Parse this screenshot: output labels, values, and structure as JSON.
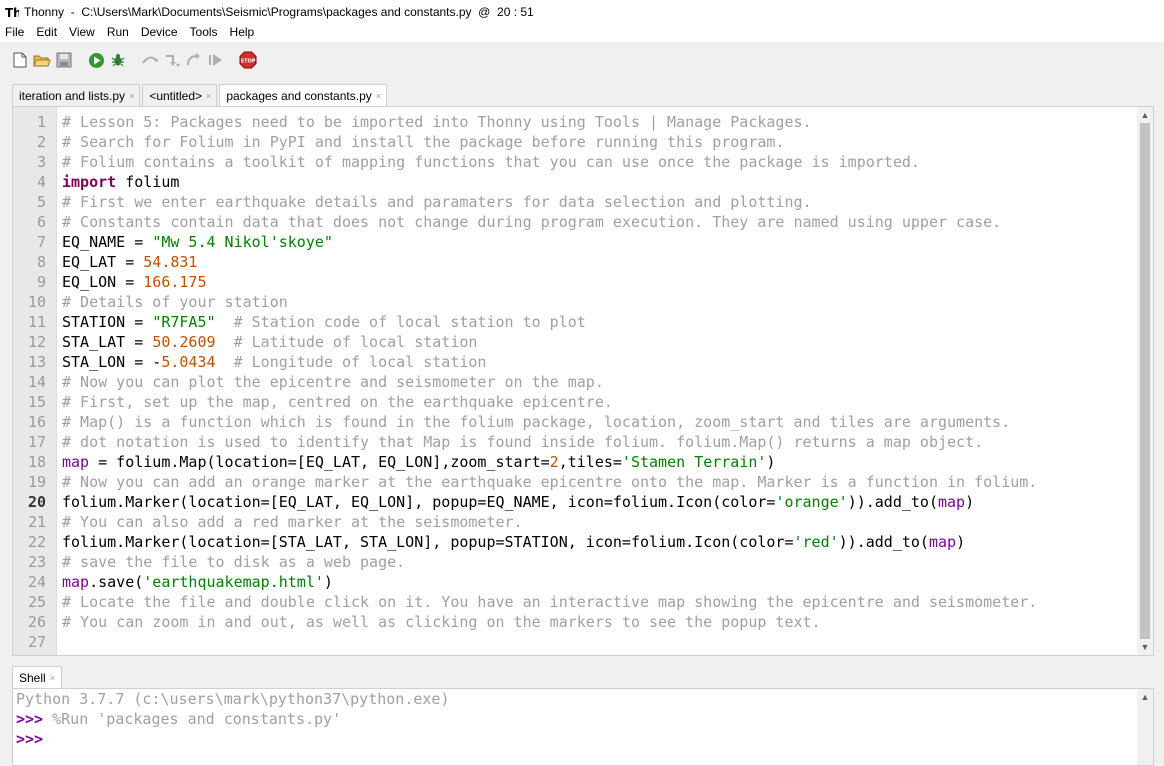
{
  "window": {
    "title": "Thonny  -  C:\\Users\\Mark\\Documents\\Seismic\\Programs\\packages and constants.py  @  20 : 51"
  },
  "menu": [
    "File",
    "Edit",
    "View",
    "Run",
    "Device",
    "Tools",
    "Help"
  ],
  "toolbar": {
    "buttons": [
      "new-file-icon",
      "open-file-icon",
      "save-icon",
      "run-icon",
      "debug-icon",
      "step-over-icon",
      "step-into-icon",
      "step-out-icon",
      "resume-icon",
      "stop-icon"
    ],
    "stop_label": "STOP"
  },
  "tabs": [
    {
      "label": "iteration and lists.py",
      "close": "×"
    },
    {
      "label": "<untitled>",
      "close": "×"
    },
    {
      "label": "packages and constants.py",
      "close": "×"
    }
  ],
  "editor": {
    "current_line": 20,
    "line_numbers": [
      "1",
      "2",
      "3",
      "4",
      "5",
      "6",
      "7",
      "8",
      "9",
      "10",
      "11",
      "12",
      "13",
      "14",
      "15",
      "16",
      "17",
      "18",
      "19",
      "20",
      "21",
      "22",
      "23",
      "24",
      "25",
      "26",
      "27"
    ],
    "lines": [
      "# Lesson 5: Packages need to be imported into Thonny using Tools | Manage Packages.",
      "# Search for Folium in PyPI and install the package before running this program.",
      "# Folium contains a toolkit of mapping functions that you can use once the package is imported.",
      "import folium",
      "# First we enter earthquake details and paramaters for data selection and plotting.",
      "# Constants contain data that does not change during program execution. They are named using upper case.",
      "EQ_NAME = \"Mw 5.4 Nikol'skoye\"",
      "EQ_LAT = 54.831",
      "EQ_LON = 166.175",
      "# Details of your station",
      "STATION = \"R7FA5\"  # Station code of local station to plot",
      "STA_LAT = 50.2609  # Latitude of local station",
      "STA_LON = -5.0434  # Longitude of local station",
      "# Now you can plot the epicentre and seismometer on the map.",
      "# First, set up the map, centred on the earthquake epicentre.",
      "# Map() is a function which is found in the folium package, location, zoom_start and tiles are arguments.",
      "# dot notation is used to identify that Map is found inside folium. folium.Map() returns a map object.",
      "map = folium.Map(location=[EQ_LAT, EQ_LON],zoom_start=2,tiles='Stamen Terrain')",
      "# Now you can add an orange marker at the earthquake epicentre onto the map. Marker is a function in folium.",
      "folium.Marker(location=[EQ_LAT, EQ_LON], popup=EQ_NAME, icon=folium.Icon(color='orange')).add_to(map)",
      "# You can also add a red marker at the seismometer.",
      "folium.Marker(location=[STA_LAT, STA_LON], popup=STATION, icon=folium.Icon(color='red')).add_to(map)",
      "# save the file to disk as a web page.",
      "map.save('earthquakemap.html')",
      "# Locate the file and double click on it. You have an interactive map showing the epicentre and seismometer.",
      "# You can zoom in and out, as well as clicking on the markers to see the popup text.",
      ""
    ]
  },
  "shell": {
    "tab_label": "Shell",
    "close": "×",
    "banner": "Python 3.7.7 (c:\\users\\mark\\python37\\python.exe)",
    "prompt": ">>>",
    "command": " %Run 'packages and constants.py'"
  },
  "colors": {
    "comment": "#a0a0a0",
    "keyword": "#7f0055",
    "string": "#008000",
    "number": "#c05000",
    "prompt": "#8000a0"
  }
}
